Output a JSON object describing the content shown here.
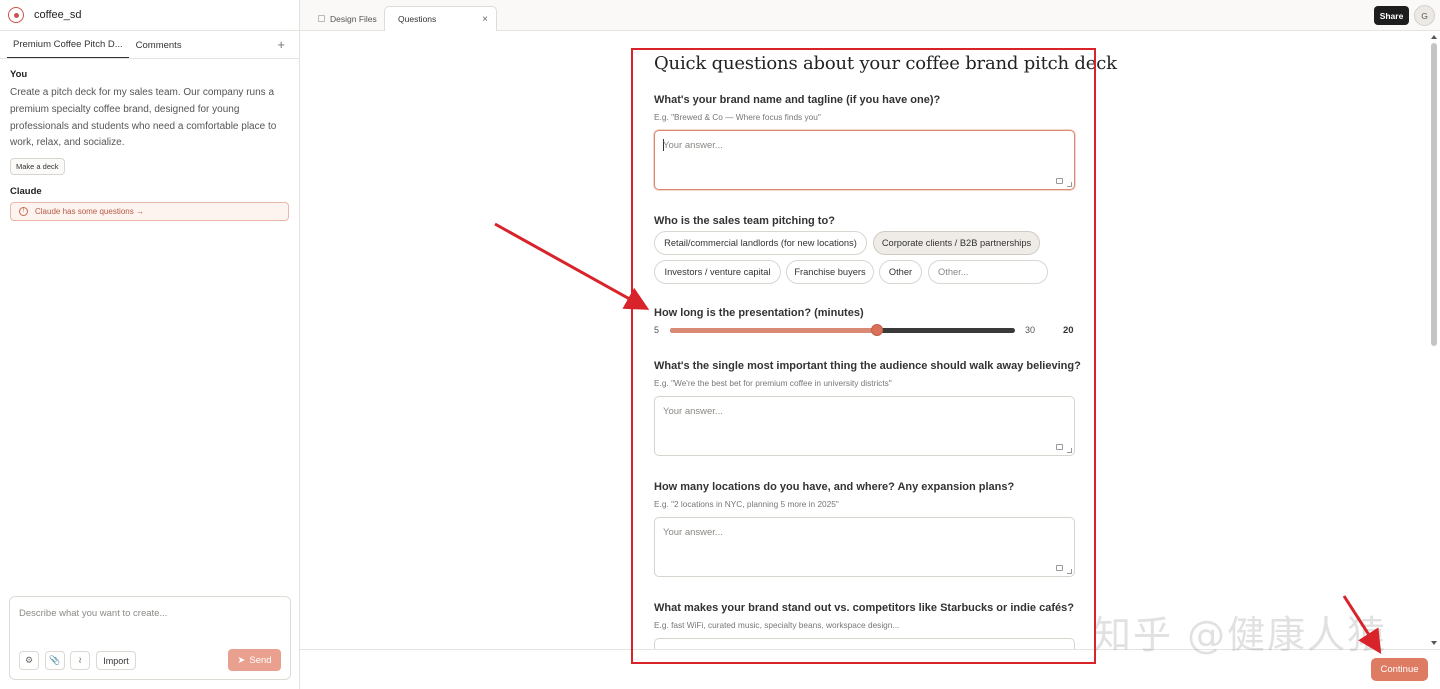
{
  "project": {
    "name": "coffee_sd",
    "icon": "palette-icon"
  },
  "left_tabs": {
    "active": "Premium Coffee Pitch D...",
    "comments": "Comments",
    "add": "+"
  },
  "chat": {
    "user_role": "You",
    "user_message": "Create a pitch deck for my sales team. Our company runs a premium specialty coffee brand, designed for young professionals and students who need a comfortable place to work, relax, and socialize.",
    "action_chip": "Make a deck",
    "assistant_role": "Claude",
    "assistant_note": "Claude has some questions →"
  },
  "composer": {
    "placeholder": "Describe what you want to create...",
    "import": "Import",
    "send": "Send"
  },
  "topbar": {
    "tab_files": "Design Files",
    "tab_questions": "Questions",
    "close": "×",
    "share": "Share",
    "avatar": "G"
  },
  "form": {
    "title": "Quick questions about your coffee brand pitch deck",
    "answer_placeholder": "Your answer...",
    "q1": {
      "label": "What's your brand name and tagline (if you have one)?",
      "hint": "E.g. \"Brewed & Co — Where focus finds you\""
    },
    "q2": {
      "label": "Who is the sales team pitching to?",
      "options": [
        "Retail/commercial landlords (for new locations)",
        "Corporate clients / B2B partnerships",
        "Investors / venture capital",
        "Franchise buyers",
        "Other"
      ],
      "selected": "Corporate clients / B2B partnerships",
      "other_placeholder": "Other..."
    },
    "q3": {
      "label": "How long is the presentation? (minutes)",
      "min": "5",
      "max": "30",
      "value": "20",
      "fraction": 0.6
    },
    "q4": {
      "label": "What's the single most important thing the audience should walk away believing?",
      "hint": "E.g. \"We're the best bet for premium coffee in university districts\""
    },
    "q5": {
      "label": "How many locations do you have, and where? Any expansion plans?",
      "hint": "E.g. \"2 locations in NYC, planning 5 more in 2025\""
    },
    "q6": {
      "label": "What makes your brand stand out vs. competitors like Starbucks or indie cafés?",
      "hint": "E.g. fast WiFi, curated music, specialty beans, workspace design..."
    }
  },
  "footer": {
    "continue": "Continue"
  },
  "watermark": "知乎 @健康人猿",
  "colors": {
    "accent": "#de7b63",
    "annotation": "#d8232a"
  }
}
